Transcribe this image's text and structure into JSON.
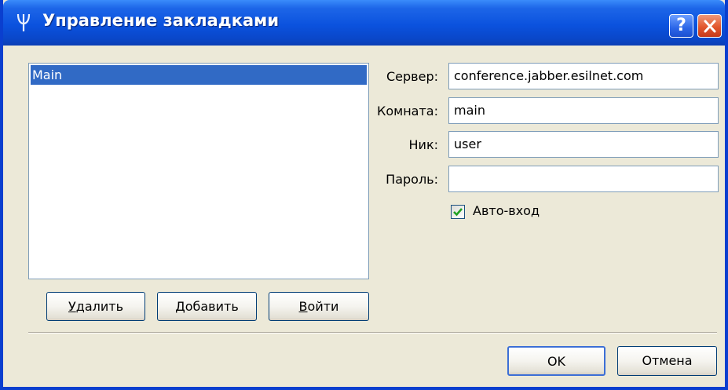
{
  "window": {
    "title": "Управление закладками",
    "help_label": "?",
    "colors": {
      "titlebar": "#0b52de",
      "face": "#ece9d8",
      "selection": "#316ac5",
      "close": "#e2572d"
    }
  },
  "bookmarks": {
    "items": [
      {
        "label": "Main",
        "selected": true
      }
    ]
  },
  "buttons": {
    "delete_accel": "У",
    "delete_rest": "далить",
    "add_accel": "Д",
    "add_rest": "обавить",
    "enter_accel": "В",
    "enter_rest": "ойти",
    "ok": "OK",
    "cancel": "Отмена"
  },
  "fields": {
    "server_label": "Сервер:",
    "server_value": "conference.jabber.esilnet.com",
    "room_label": "Комната:",
    "room_value": "main",
    "nick_label": "Ник:",
    "nick_value": "user",
    "password_label": "Пароль:",
    "password_value": ""
  },
  "autojoin": {
    "label": "Авто-вход",
    "checked": true
  }
}
